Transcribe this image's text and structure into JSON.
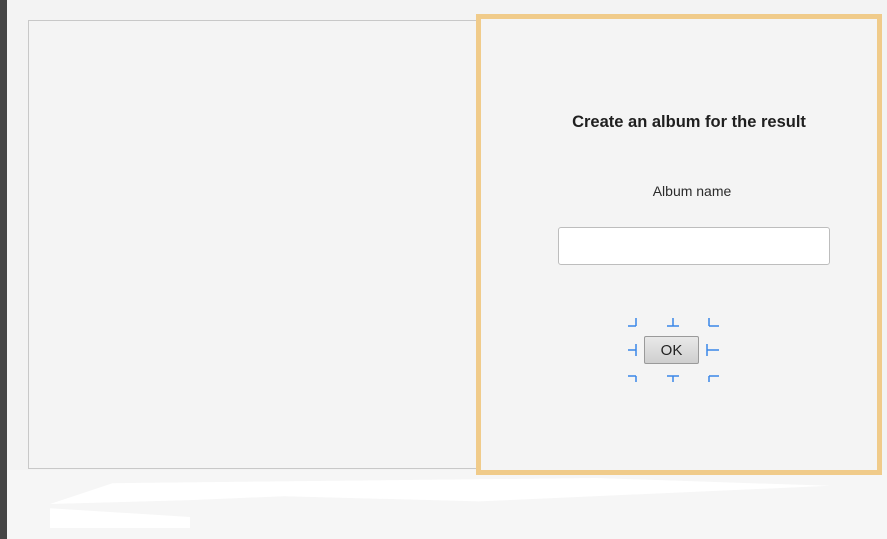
{
  "dialog": {
    "title": "Create an album for the result",
    "album_name_label": "Album name",
    "album_name_value": "",
    "album_name_placeholder": "",
    "ok_label": "OK"
  },
  "colors": {
    "panel_border": "#f0cb8a",
    "selection_handles": "#3a86e8"
  }
}
